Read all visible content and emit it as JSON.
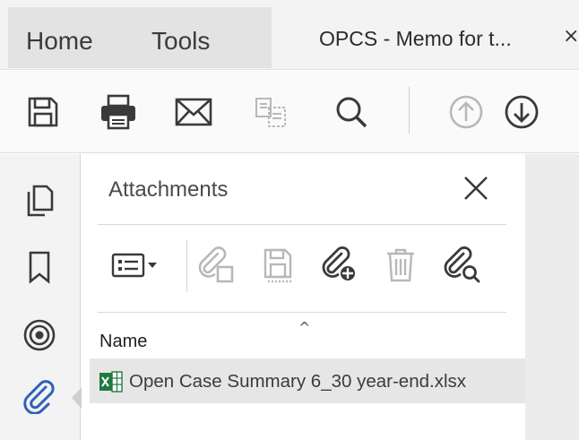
{
  "tabs": {
    "home_label": "Home",
    "tools_label": "Tools",
    "document_title": "OPCS - Memo for t...",
    "close_glyph": "×"
  },
  "toolbar": {
    "icons": [
      "save-icon",
      "print-icon",
      "email-icon",
      "compare-icon",
      "search-icon",
      "page-up-icon",
      "page-down-icon"
    ]
  },
  "rail": {
    "icons": [
      "pages-icon",
      "bookmark-icon",
      "layers-icon",
      "attachment-icon"
    ],
    "active": "attachment-icon",
    "accent_color": "#2d62b8"
  },
  "attachments": {
    "title": "Attachments",
    "toolbar_icons": [
      "options-menu-icon",
      "open-attachment-icon",
      "save-attachment-icon",
      "add-attachment-icon",
      "delete-icon",
      "search-attachment-icon"
    ],
    "sort_caret": "^",
    "column_header": "Name",
    "files": [
      {
        "name": "Open Case Summary 6_30 year-end.xlsx",
        "icon": "excel-file-icon",
        "selected": true
      }
    ]
  },
  "colors": {
    "icon_active": "#3a3a3a",
    "icon_disabled": "#b8b8b8",
    "excel_green": "#1f7a3f"
  }
}
